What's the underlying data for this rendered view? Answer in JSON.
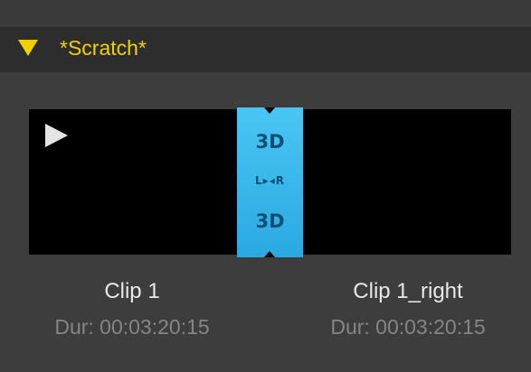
{
  "panel": {
    "title": "*Scratch*",
    "collapse_icon": "triangle-down-icon",
    "title_color": "#f2d000"
  },
  "viewer": {
    "play_icon": "play-icon",
    "stereo_marker": {
      "top_label": "3D",
      "middle_label": "L▸◂R",
      "bottom_label": "3D",
      "color": "#2aa9e2"
    }
  },
  "clips": [
    {
      "name": "Clip 1",
      "duration": "Dur: 00:03:20:15"
    },
    {
      "name": "Clip 1_right",
      "duration": "Dur: 00:03:20:15"
    }
  ]
}
